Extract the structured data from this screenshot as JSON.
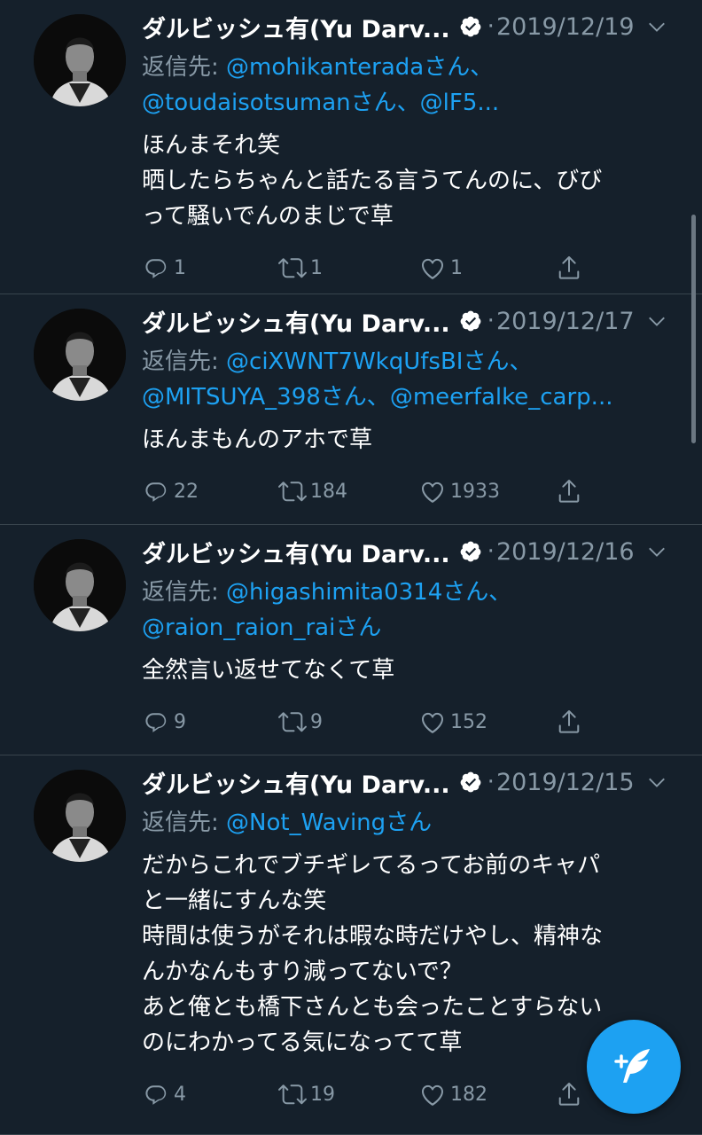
{
  "colors": {
    "background": "#15202b",
    "accent": "#1da1f2",
    "muted": "#8899a6",
    "divider": "#38444d"
  },
  "tweets": [
    {
      "name": "ダルビッシュ有(Yu Darv...",
      "date": "2019/12/19",
      "reply_prefix": "返信先: ",
      "reply_line1_mention": "@mohikanterada",
      "reply_line1_suffix": "さん、",
      "reply_line2_mention1": "@toudaisotsuman",
      "reply_line2_sep": "さん、",
      "reply_line2_mention2": "@lF5...",
      "body": [
        "ほんまそれ笑",
        "晒したらちゃんと話たる言うてんのに、びび",
        "って騒いでんのまじで草"
      ],
      "replies": "1",
      "retweets": "1",
      "likes": "1"
    },
    {
      "name": "ダルビッシュ有(Yu Darv...",
      "date": "2019/12/17",
      "reply_prefix": "返信先: ",
      "reply_line1_mention": "@ciXWNT7WkqUfsBI",
      "reply_line1_suffix": "さん、",
      "reply_line2_mention1": "@MITSUYA_398",
      "reply_line2_sep": "さん、",
      "reply_line2_mention2": "@meerfalke_carp...",
      "body": [
        "ほんまもんのアホで草"
      ],
      "replies": "22",
      "retweets": "184",
      "likes": "1933"
    },
    {
      "name": "ダルビッシュ有(Yu Darv...",
      "date": "2019/12/16",
      "reply_prefix": "返信先: ",
      "reply_line1_mention": "@higashimita0314",
      "reply_line1_suffix": "さん、",
      "reply_line2_mention1": "@raion_raion_rai",
      "reply_line2_sep": "さん",
      "body": [
        "全然言い返せてなくて草"
      ],
      "replies": "9",
      "retweets": "9",
      "likes": "152"
    },
    {
      "name": "ダルビッシュ有(Yu Darv...",
      "date": "2019/12/15",
      "reply_prefix": "返信先: ",
      "reply_line1_mention": "@Not_Waving",
      "reply_line1_suffix": "さん",
      "body": [
        "だからこれでブチギレてるってお前のキャパ",
        "と一緒にすんな笑",
        "時間は使うがそれは暇な時だけやし、精神な",
        "んかなんもすり減ってないで？",
        "あと俺とも橋下さんとも会ったことすらない",
        "のにわかってる気になってて草"
      ],
      "replies": "4",
      "retweets": "19",
      "likes": "182"
    }
  ],
  "icons": {
    "verified": "verified-badge-icon",
    "caret": "chevron-down-icon",
    "reply": "reply-icon",
    "retweet": "retweet-icon",
    "like": "heart-icon",
    "share": "share-icon",
    "compose": "compose-tweet-icon"
  }
}
